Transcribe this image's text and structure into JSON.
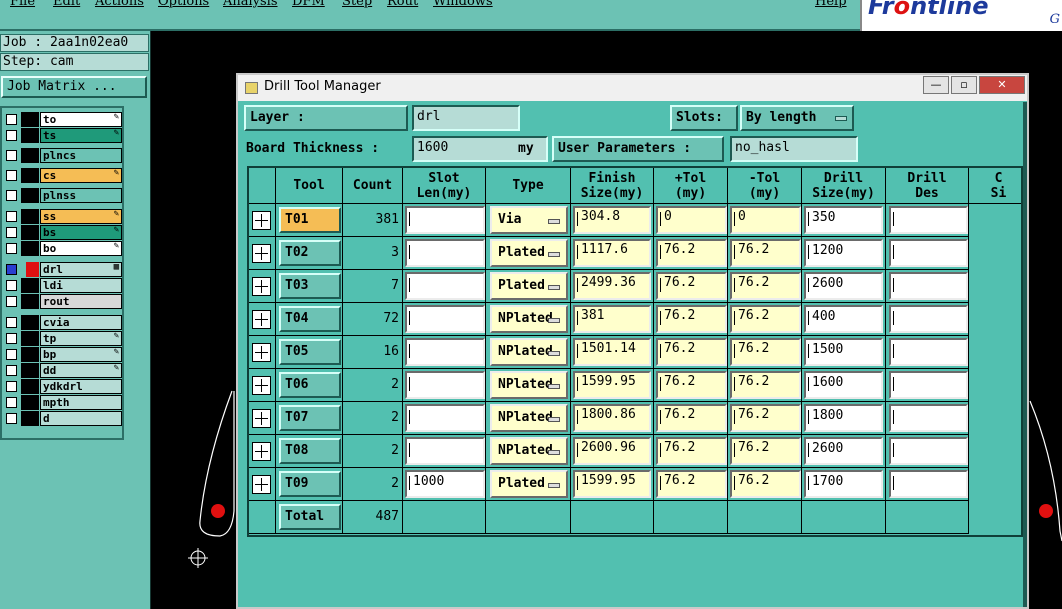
{
  "menu": {
    "items": [
      "File",
      "Edit",
      "Actions",
      "Options",
      "Analysis",
      "DFM",
      "Step",
      "Rout",
      "Windows"
    ],
    "help": "Help"
  },
  "logo": {
    "brand_prefix": "Fr",
    "brand_mid": "o",
    "brand_suffix": "ntline",
    "tail": "G"
  },
  "left_panel": {
    "job_label": "Job : 2aa1n02ea0",
    "step_label": "Step: cam",
    "job_matrix": "Job Matrix ...",
    "layers": [
      {
        "name": "to",
        "color": "#ffffff",
        "mark": "✎"
      },
      {
        "name": "ts",
        "color": "#1f9a7a",
        "mark": "✎"
      },
      {
        "name": "plncs",
        "color": "#6cc2b4",
        "mark": ""
      },
      {
        "name": "cs",
        "color": "#f5bd55",
        "mark": "✎"
      },
      {
        "name": "plnss",
        "color": "#6cc2b4",
        "mark": ""
      },
      {
        "name": "ss",
        "color": "#f5bd55",
        "mark": "✎"
      },
      {
        "name": "bs",
        "color": "#1f9a7a",
        "mark": "✎"
      },
      {
        "name": "bo",
        "color": "#ffffff",
        "mark": "✎"
      },
      {
        "name": "drl",
        "color": "#b6dcd6",
        "mark": "▦"
      },
      {
        "name": "ldi",
        "color": "#b6dcd6",
        "mark": ""
      },
      {
        "name": "rout",
        "color": "#d8d8d8",
        "mark": ""
      },
      {
        "name": "cvia",
        "color": "#b6dcd6",
        "mark": ""
      },
      {
        "name": "tp",
        "color": "#b6dcd6",
        "mark": "✎"
      },
      {
        "name": "bp",
        "color": "#b6dcd6",
        "mark": "✎"
      },
      {
        "name": "dd",
        "color": "#b6dcd6",
        "mark": "✎"
      },
      {
        "name": "ydkdrl",
        "color": "#b6dcd6",
        "mark": ""
      },
      {
        "name": "mpth",
        "color": "#b6dcd6",
        "mark": ""
      },
      {
        "name": "d",
        "color": "#b6dcd6",
        "mark": ""
      }
    ]
  },
  "dialog": {
    "title": "Drill Tool Manager",
    "window_buttons": {
      "minimize": "—",
      "maximize": "▫",
      "close": "✕"
    },
    "layer_label": "Layer        :",
    "layer_value": "drl",
    "slots_label": "Slots:",
    "slots_value": "By length",
    "board_thickness_label": "Board Thickness :",
    "board_thickness_value": "1600",
    "board_thickness_unit": "my",
    "user_params_label": "User Parameters :",
    "user_params_value": "no_hasl",
    "headers": [
      "Tool",
      "Count",
      "Slot\nLen(my)",
      "Type",
      "Finish\nSize(my)",
      "+Tol\n(my)",
      "-Tol\n(my)",
      "Drill\nSize(my)",
      "Drill\nDes",
      "C\nSi"
    ],
    "rows": [
      {
        "tool": "T01",
        "count": "381",
        "slot": "",
        "type": "Via",
        "finish": "304.8",
        "ptol": "0",
        "ntol": "0",
        "drill": "350",
        "des": ""
      },
      {
        "tool": "T02",
        "count": "3",
        "slot": "",
        "type": "Plated",
        "finish": "1117.6",
        "ptol": "76.2",
        "ntol": "76.2",
        "drill": "1200",
        "des": ""
      },
      {
        "tool": "T03",
        "count": "7",
        "slot": "",
        "type": "Plated",
        "finish": "2499.36",
        "ptol": "76.2",
        "ntol": "76.2",
        "drill": "2600",
        "des": ""
      },
      {
        "tool": "T04",
        "count": "72",
        "slot": "",
        "type": "NPlated",
        "finish": "381",
        "ptol": "76.2",
        "ntol": "76.2",
        "drill": "400",
        "des": ""
      },
      {
        "tool": "T05",
        "count": "16",
        "slot": "",
        "type": "NPlated",
        "finish": "1501.14",
        "ptol": "76.2",
        "ntol": "76.2",
        "drill": "1500",
        "des": ""
      },
      {
        "tool": "T06",
        "count": "2",
        "slot": "",
        "type": "NPlated",
        "finish": "1599.95",
        "ptol": "76.2",
        "ntol": "76.2",
        "drill": "1600",
        "des": ""
      },
      {
        "tool": "T07",
        "count": "2",
        "slot": "",
        "type": "NPlated",
        "finish": "1800.86",
        "ptol": "76.2",
        "ntol": "76.2",
        "drill": "1800",
        "des": ""
      },
      {
        "tool": "T08",
        "count": "2",
        "slot": "",
        "type": "NPlated",
        "finish": "2600.96",
        "ptol": "76.2",
        "ntol": "76.2",
        "drill": "2600",
        "des": ""
      },
      {
        "tool": "T09",
        "count": "2",
        "slot": "1000",
        "type": "Plated",
        "finish": "1599.95",
        "ptol": "76.2",
        "ntol": "76.2",
        "drill": "1700",
        "des": ""
      }
    ],
    "total_label": "Total",
    "total_count": "487"
  }
}
